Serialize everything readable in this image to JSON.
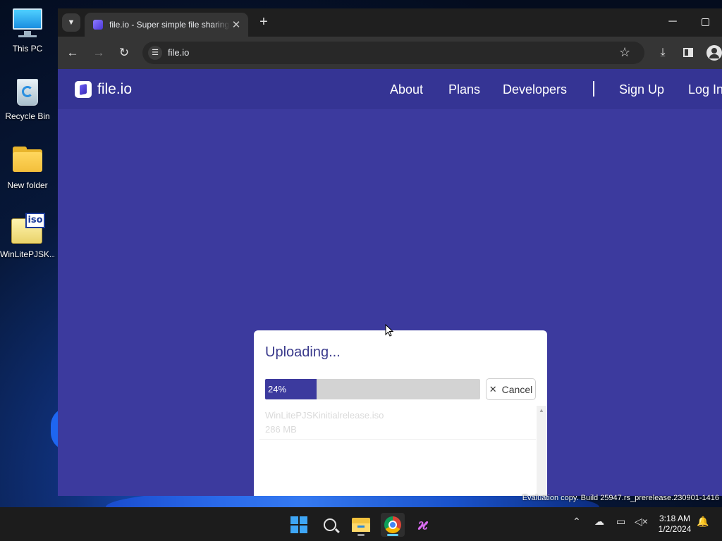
{
  "desktop": {
    "icons": [
      {
        "label": "This PC"
      },
      {
        "label": "Recycle Bin"
      },
      {
        "label": "New folder"
      },
      {
        "label": "WinLitePJSK..."
      }
    ],
    "iso_tag": "iso",
    "watermark": "Evaluation copy. Build 25947.rs_prerelease.230901-1416"
  },
  "browser": {
    "tab_title": "file.io - Super simple file sharing",
    "url": "file.io",
    "icons": {
      "tab_search": "chevron-down-icon",
      "tab_close": "close-icon",
      "new_tab": "plus-icon",
      "back": "arrow-left-icon",
      "forward": "arrow-right-icon",
      "reload": "reload-icon",
      "site_info": "tune-icon",
      "bookmark": "star-icon",
      "downloads": "download-icon",
      "side_panel": "side-panel-icon",
      "profile": "profile-icon"
    }
  },
  "site": {
    "logo_text": "file.io",
    "nav": {
      "about": "About",
      "plans": "Plans",
      "developers": "Developers",
      "sign_up": "Sign Up",
      "log_in": "Log In"
    },
    "colors": {
      "brand": "#3c3a9e",
      "header": "#353494"
    }
  },
  "upload": {
    "title": "Uploading...",
    "progress_percent": 24,
    "progress_text": "24%",
    "cancel_label": "Cancel",
    "file": {
      "name": "WinLitePJSKinitialrelease.iso",
      "size": "286 MB"
    }
  },
  "taskbar": {
    "apps": [
      "start",
      "search",
      "file-explorer",
      "chrome",
      "paint"
    ],
    "clock": {
      "time": "3:18 AM",
      "date": "1/2/2024"
    }
  }
}
